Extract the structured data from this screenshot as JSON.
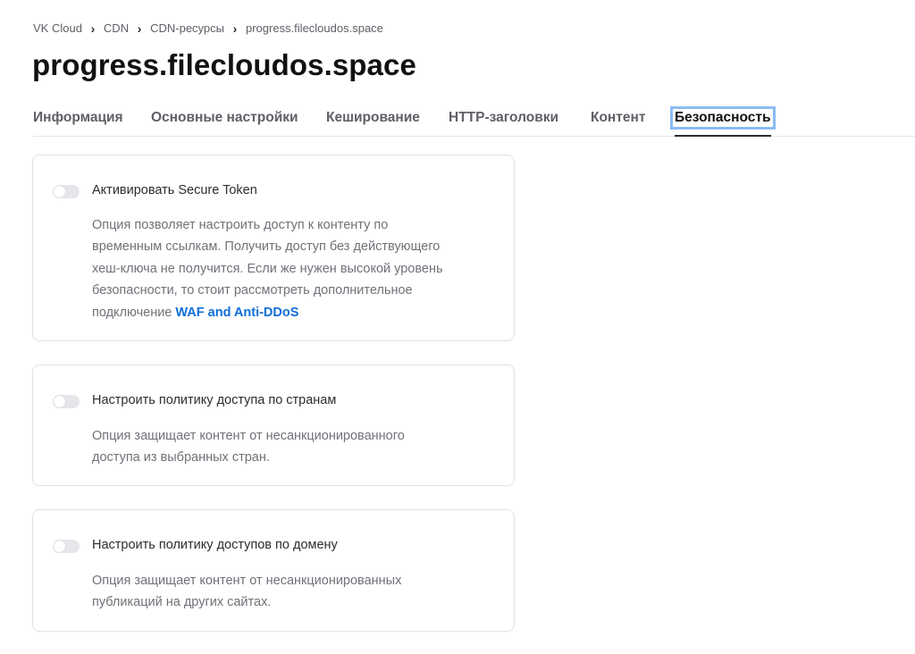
{
  "breadcrumb": {
    "items": [
      "VK Cloud",
      "CDN",
      "CDN-ресурсы",
      "progress.filecloudos.space"
    ],
    "separator": "›"
  },
  "page_title": "progress.filecloudos.space",
  "tabs": [
    {
      "label": "Информация",
      "active": false
    },
    {
      "label": "Основные настройки",
      "active": false
    },
    {
      "label": "Кеширование",
      "active": false
    },
    {
      "label": "HTTP-заголовки",
      "active": false
    },
    {
      "label": "Контент",
      "active": false
    },
    {
      "label": "Безопасность",
      "active": true
    }
  ],
  "cards": {
    "secure_token": {
      "enabled": false,
      "label": "Активировать Secure Token",
      "desc_lines": [
        "Опция позволяет настроить доступ к контенту по",
        "временным ссылкам. Получить доступ без действующего",
        "хеш-ключа не получится. Если же нужен высокой уровень",
        "безопасности, то стоит рассмотреть дополнительное",
        "подключение "
      ],
      "link_label": "WAF and Anti-DDoS"
    },
    "country_policy": {
      "enabled": false,
      "label": "Настроить политику доступа по странам",
      "desc_lines": [
        "Опция защищает контент от несанкционированного",
        "доступа из выбранных стран."
      ]
    },
    "domain_policy": {
      "enabled": false,
      "label": "Настроить политику доступов по домену",
      "desc_lines": [
        "Опция защищает контент от несанкционированных",
        "публикаций на других сайтах."
      ]
    }
  },
  "colors": {
    "link": "#0d6ed8",
    "focus_ring": "#8bbcf2",
    "toggle_off": "#e4e6ea",
    "text_muted": "#6f7278"
  }
}
